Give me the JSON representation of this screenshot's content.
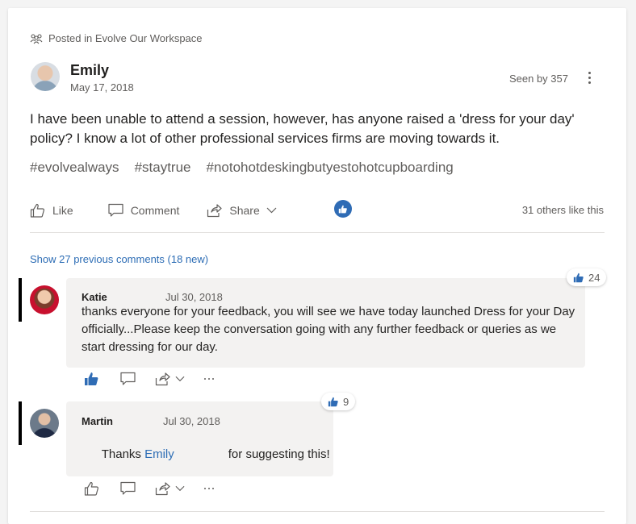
{
  "post": {
    "posted_in": "Posted in Evolve Our Workspace",
    "author": "Emily",
    "date": "May 17, 2018",
    "seen_by": "Seen by 357",
    "body": "I have been unable to attend a session, however, has anyone raised a 'dress for your day' policy?  I know a lot of other professional services firms are moving towards it.",
    "hashtags": [
      "#evolvealways",
      "#staytrue",
      "#notohotdeskingbutyestohotcupboarding"
    ],
    "actions": {
      "like": "Like",
      "comment": "Comment",
      "share": "Share"
    },
    "others_like": "31 others like this"
  },
  "comments_header": {
    "show_previous": "Show 27 previous comments (18 new)"
  },
  "comments": [
    {
      "author": "Katie",
      "date": "Jul 30, 2018",
      "text": "thanks everyone for your feedback, you will see we have today launched Dress for your Day officially...Please keep the conversation going with any further feedback or queries as we start dressing for our day.",
      "likes": "24",
      "liked_by_me": true
    },
    {
      "author": "Martin",
      "date": "Jul 30, 2018",
      "text_before": "Thanks ",
      "mention": "Emily",
      "text_after": "for suggesting this!",
      "likes": "9",
      "liked_by_me": false
    }
  ],
  "icons": {
    "group": "people-group-icon",
    "like": "thumbs-up-icon",
    "comment": "speech-bubble-icon",
    "share": "share-arrow-icon",
    "chevron": "chevron-down-icon",
    "more": "more-dots-icon"
  },
  "colors": {
    "accent": "#2f6cb5",
    "link": "#2d6db5",
    "bubble": "#f3f2f1",
    "muted_text": "#605e5c"
  }
}
